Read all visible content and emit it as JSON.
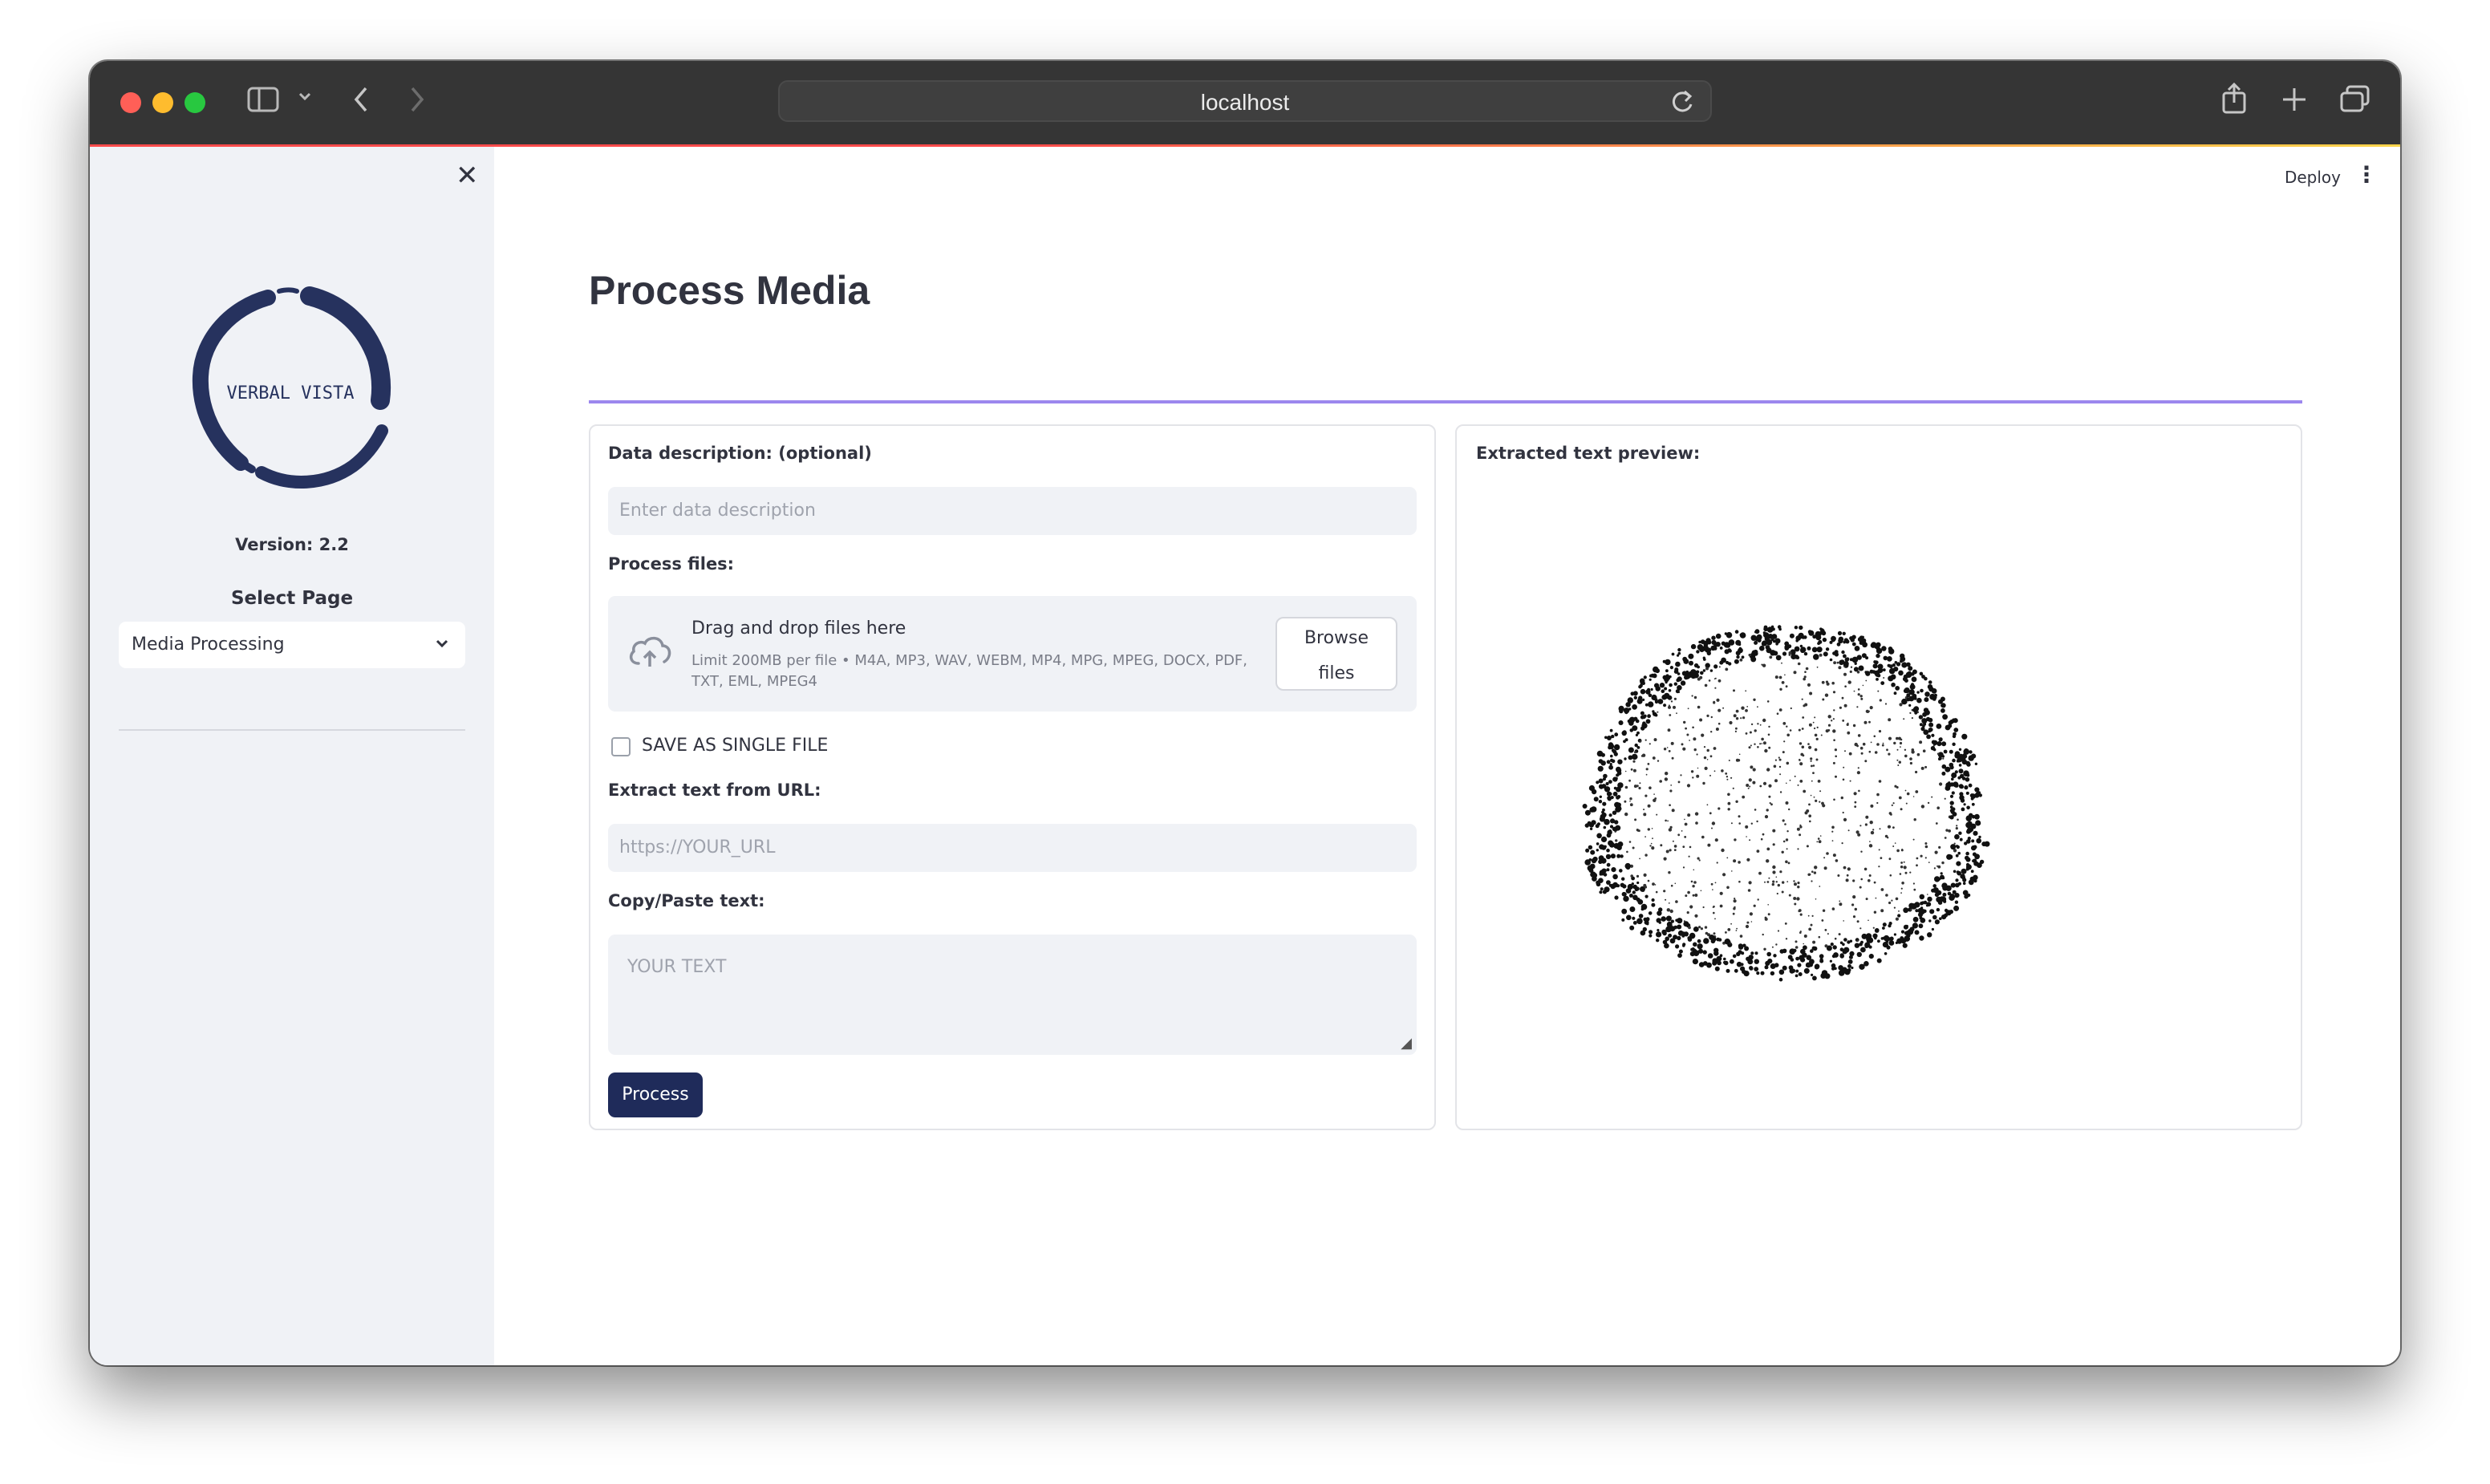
{
  "browser": {
    "url": "localhost",
    "traffic_lights": {
      "close": "#ff5f57",
      "minimize": "#febc2e",
      "zoom": "#28c840"
    },
    "icons": [
      "sidebar-toggle-icon",
      "chevron-down-icon",
      "back-icon",
      "forward-icon",
      "reload-icon",
      "share-icon",
      "new-tab-icon",
      "tab-overview-icon"
    ]
  },
  "sidebar": {
    "logo_text": "VERBAL VISTA",
    "version": "Version: 2.2",
    "select_label": "Select Page",
    "select_value": "Media Processing"
  },
  "header": {
    "deploy_label": "Deploy"
  },
  "main": {
    "title": "Process Media",
    "form": {
      "description_label": "Data description: (optional)",
      "description_placeholder": "Enter data description",
      "files_label": "Process files:",
      "dropzone_title": "Drag and drop files here",
      "dropzone_limit": "Limit 200MB per file • M4A, MP3, WAV, WEBM, MP4, MPG, MPEG, DOCX, PDF, TXT, EML, MPEG4",
      "browse_line1": "Browse",
      "browse_line2": "files",
      "single_file_label": "SAVE AS SINGLE FILE",
      "single_file_checked": false,
      "url_label": "Extract text from URL:",
      "url_placeholder": "https://YOUR_URL",
      "paste_label": "Copy/Paste text:",
      "paste_placeholder": "YOUR TEXT",
      "process_button": "Process"
    },
    "preview": {
      "label": "Extracted text preview:"
    }
  },
  "colors": {
    "primary_button": "#1f2b5a",
    "title_rule": "#9c87ee",
    "sidebar_bg": "#f0f2f6",
    "logo_ink": "#26325e"
  }
}
